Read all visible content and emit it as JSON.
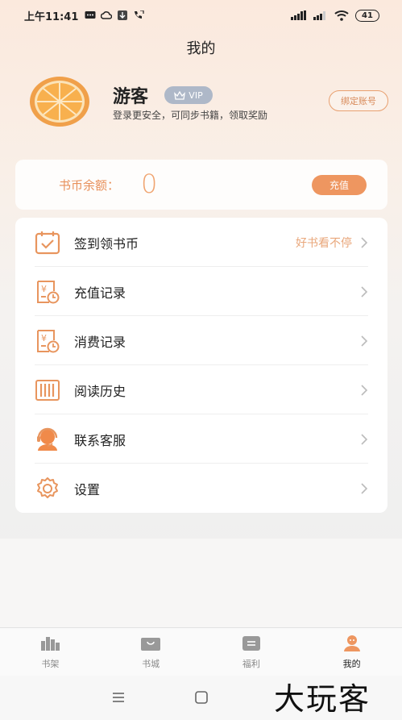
{
  "status_bar": {
    "time": "上午11:41",
    "battery": "41"
  },
  "page": {
    "title": "我的"
  },
  "profile": {
    "username": "游客",
    "vip_label": "VIP",
    "subtitle": "登录更安全，可同步书籍，领取奖励",
    "bind_button": "绑定账号"
  },
  "balance": {
    "label": "书币余额：",
    "value": "0",
    "recharge_button": "充值"
  },
  "menu": {
    "items": [
      {
        "label": "签到领书币",
        "extra": "好书看不停",
        "icon": "calendar-check-icon"
      },
      {
        "label": "充值记录",
        "extra": "",
        "icon": "recharge-record-icon"
      },
      {
        "label": "消费记录",
        "extra": "",
        "icon": "consume-record-icon"
      },
      {
        "label": "阅读历史",
        "extra": "",
        "icon": "book-history-icon"
      },
      {
        "label": "联系客服",
        "extra": "",
        "icon": "customer-service-icon"
      },
      {
        "label": "设置",
        "extra": "",
        "icon": "gear-icon"
      }
    ]
  },
  "bottom_nav": {
    "items": [
      {
        "label": "书架",
        "icon": "bookshelf-icon",
        "active": false
      },
      {
        "label": "书城",
        "icon": "bookstore-icon",
        "active": false
      },
      {
        "label": "福利",
        "icon": "welfare-icon",
        "active": false
      },
      {
        "label": "我的",
        "icon": "profile-icon",
        "active": true
      }
    ]
  },
  "watermark": "大玩客",
  "colors": {
    "accent": "#ee9660",
    "accent_text": "#e8905b",
    "vip_badge": "#aeb8c8"
  }
}
